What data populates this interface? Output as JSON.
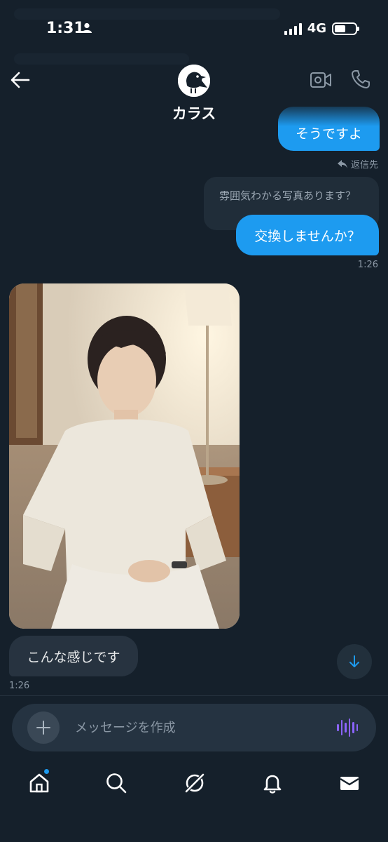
{
  "status_bar": {
    "time": "1:31",
    "network": "4G"
  },
  "header": {
    "contact_name": "カラス"
  },
  "messages": {
    "partial_outgoing": "そうですよ",
    "reply_label": "返信先",
    "quoted_text": "雰囲気わかる写真あります？",
    "outgoing_text": "交換しませんか？",
    "outgoing_time": "1:26",
    "incoming_text": "こんな感じです",
    "incoming_time": "1:26"
  },
  "composer": {
    "placeholder": "メッセージを作成"
  },
  "colors": {
    "background": "#15202b",
    "accent": "#1d9bf0",
    "incoming_bubble": "#273340",
    "voice_icon": "#8c64ff"
  },
  "icons": {
    "header": [
      "back-arrow-icon",
      "crow-avatar-icon",
      "video-call-icon",
      "phone-icon"
    ],
    "nav": [
      "home-icon",
      "search-icon",
      "grok-icon",
      "notifications-icon",
      "messages-icon"
    ]
  }
}
